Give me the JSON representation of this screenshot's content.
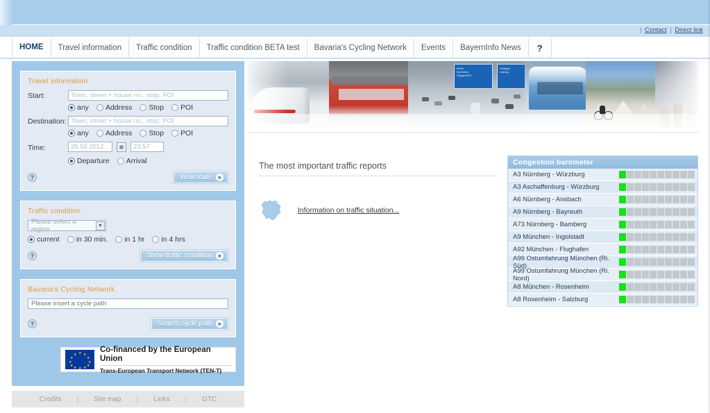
{
  "header": {
    "util_links": [
      {
        "label": "Contact"
      },
      {
        "label": "Direct link"
      }
    ],
    "separator": "|"
  },
  "nav": {
    "tabs": [
      {
        "label": "HOME",
        "active": true
      },
      {
        "label": "Travel information",
        "active": false
      },
      {
        "label": "Traffic condition",
        "active": false
      },
      {
        "label": "Traffic condition BETA test",
        "active": false
      },
      {
        "label": "Bavaria's Cycling Network",
        "active": false
      },
      {
        "label": "Events",
        "active": false
      },
      {
        "label": "BayernInfo News",
        "active": false
      },
      {
        "label": "?",
        "active": false
      }
    ]
  },
  "travel_panel": {
    "title": "Travel information",
    "start_label": "Start:",
    "start_placeholder": "Town, street + house no., stop, POI",
    "start_value": "",
    "start_options": [
      "any",
      "Address",
      "Stop",
      "POI"
    ],
    "start_selected": "any",
    "destination_label": "Destination:",
    "destination_placeholder": "Town, street + house no., stop, POI",
    "destination_value": "",
    "destination_options": [
      "any",
      "Address",
      "Stop",
      "POI"
    ],
    "destination_selected": "any",
    "time_label": "Time:",
    "date_value": "26.02.2012",
    "time_value": "23:57",
    "calendar_icon": "calendar-icon",
    "when_options": [
      "Departure",
      "Arrival"
    ],
    "when_selected": "Departure",
    "help_icon": "?",
    "submit_label": "View route"
  },
  "traffic_panel": {
    "title": "Traffic condition",
    "region_select_value": "Please select a region",
    "region_options": [
      "Please select a region"
    ],
    "time_options": [
      "current",
      "in 30 min.",
      "in 1 hr",
      "in 4 hrs"
    ],
    "time_selected": "current",
    "help_icon": "?",
    "submit_label": "Show traffic condition"
  },
  "cycling_panel": {
    "title": "Bavaria's Cycling Network",
    "input_placeholder": "Please insert a cycle path",
    "input_value": "",
    "help_icon": "?",
    "submit_label": "Search cycle path"
  },
  "eu_banner": {
    "line1": "Co-financed by the European Union",
    "line2": "Trans-European Transport Network (TEN-T)",
    "flag_name": "european-union-flag"
  },
  "footer": {
    "links": [
      "Credits",
      "Site map",
      "Links",
      "GTC"
    ],
    "separator": "|"
  },
  "main": {
    "reports_title": "The most important traffic reports",
    "report_link": "Information on traffic situation...",
    "map_icon": "bavaria-map-icon"
  },
  "barometer": {
    "title": "Congestion barometer",
    "segments_total": 10,
    "rows": [
      {
        "route": "A3 Nürnberg - Würzburg",
        "filled": 1
      },
      {
        "route": "A3 Aschaffenburg - Würzburg",
        "filled": 1
      },
      {
        "route": "A6 Nürnberg - Ansbach",
        "filled": 1
      },
      {
        "route": "A9 Nürnberg - Bayreuth",
        "filled": 1
      },
      {
        "route": "A73 Nürnberg - Bamberg",
        "filled": 1
      },
      {
        "route": "A9 München - Ingolstadt",
        "filled": 1
      },
      {
        "route": "A92 München - Flughafen",
        "filled": 1
      },
      {
        "route": "A99 Ostumfahrung München (Ri. Süd)",
        "filled": 1
      },
      {
        "route": "A99 Ostumfahrung München (Ri. Nord)",
        "filled": 1
      },
      {
        "route": "A8 München - Rosenheim",
        "filled": 1
      },
      {
        "route": "A8 Rosenheim - Salzburg",
        "filled": 1
      }
    ]
  },
  "colors": {
    "header_blue": "#a8cdec",
    "sidebar_blue": "#9fc8e8",
    "panel_bg": "#e3eaf4",
    "panel_title_orange": "#e09b3d",
    "barometer_green": "#18e01a",
    "barometer_gray": "#c3c8cc",
    "active_tab_text": "#16426b"
  },
  "banner": {
    "name": "transport-collage-banner",
    "scenes": [
      "ice-train",
      "red-regional-train",
      "motorway-traffic-signs",
      "blue-tram",
      "cyclist-alps",
      "station-passengers",
      "red-s-bahn"
    ]
  }
}
